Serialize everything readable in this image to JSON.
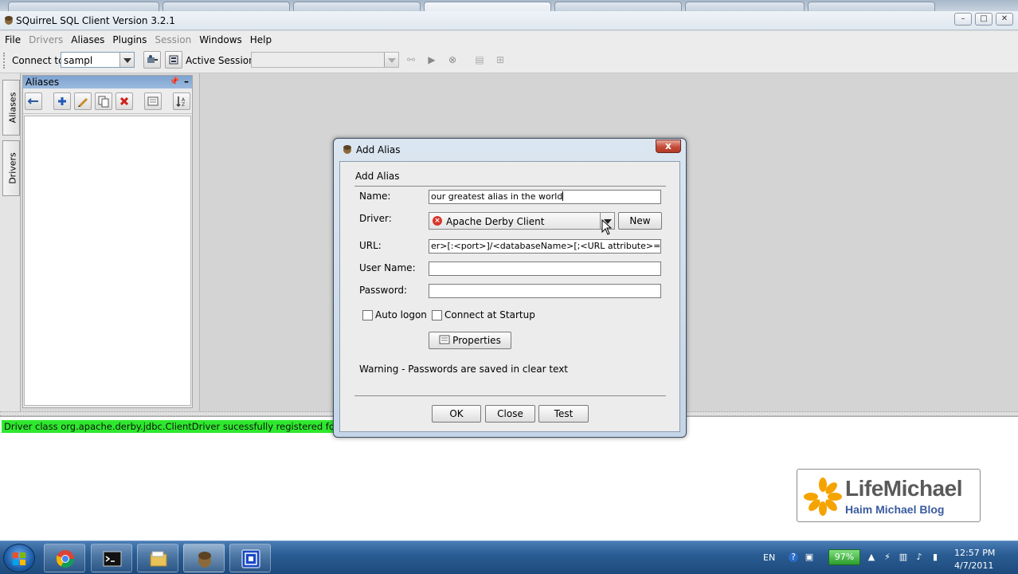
{
  "window": {
    "title": "SQuirreL SQL Client Version 3.2.1",
    "controls": {
      "minimize": "–",
      "maximize": "□",
      "close": "✕"
    }
  },
  "menubar": {
    "items": [
      {
        "label": "File",
        "enabled": true
      },
      {
        "label": "Drivers",
        "enabled": false
      },
      {
        "label": "Aliases",
        "enabled": true
      },
      {
        "label": "Plugins",
        "enabled": true
      },
      {
        "label": "Session",
        "enabled": false
      },
      {
        "label": "Windows",
        "enabled": true
      },
      {
        "label": "Help",
        "enabled": true
      }
    ]
  },
  "toolbar": {
    "connect_to_label": "Connect to:",
    "connect_to_value": "sampl",
    "active_session_label": "Active Session:",
    "active_session_value": ""
  },
  "side_tabs": {
    "aliases": "Aliases",
    "drivers": "Drivers"
  },
  "aliases_panel": {
    "title": "Aliases",
    "tool_icons": [
      "connect-icon",
      "add-icon",
      "edit-icon",
      "copy-icon",
      "delete-icon",
      "properties-icon",
      "sort-icon"
    ]
  },
  "message": {
    "text": "Driver class org.apache.derby.jdbc.ClientDriver sucessfully registered for driver d",
    "color": "#2ee82e"
  },
  "dialog": {
    "title": "Add Alias",
    "close_label": "x",
    "section_title": "Add Alias",
    "name_label": "Name:",
    "name_value": "our greatest alias in the world",
    "driver_label": "Driver:",
    "driver_value": "Apache Derby Client",
    "new_button": "New",
    "url_label": "URL:",
    "url_value": "er>[:<port>]/<databaseName>[;<URL attribute>=<value>]",
    "username_label": "User Name:",
    "username_value": "",
    "password_label": "Password:",
    "password_value": "",
    "auto_logon_label": "Auto logon",
    "auto_logon_checked": false,
    "connect_startup_label": "Connect at Startup",
    "connect_startup_checked": false,
    "properties_button": "Properties",
    "warning": "Warning - Passwords are saved in clear text",
    "ok_button": "OK",
    "close_button": "Close",
    "test_button": "Test"
  },
  "logo": {
    "brand": "LifeMichael",
    "subtitle": "Haim Michael Blog"
  },
  "taskbar": {
    "apps": [
      "chrome-icon",
      "cmd-icon",
      "explorer-icon",
      "squirrel-icon",
      "remote-icon"
    ],
    "language": "EN",
    "battery": "97%",
    "time": "12:57 PM",
    "date": "4/7/2011"
  }
}
